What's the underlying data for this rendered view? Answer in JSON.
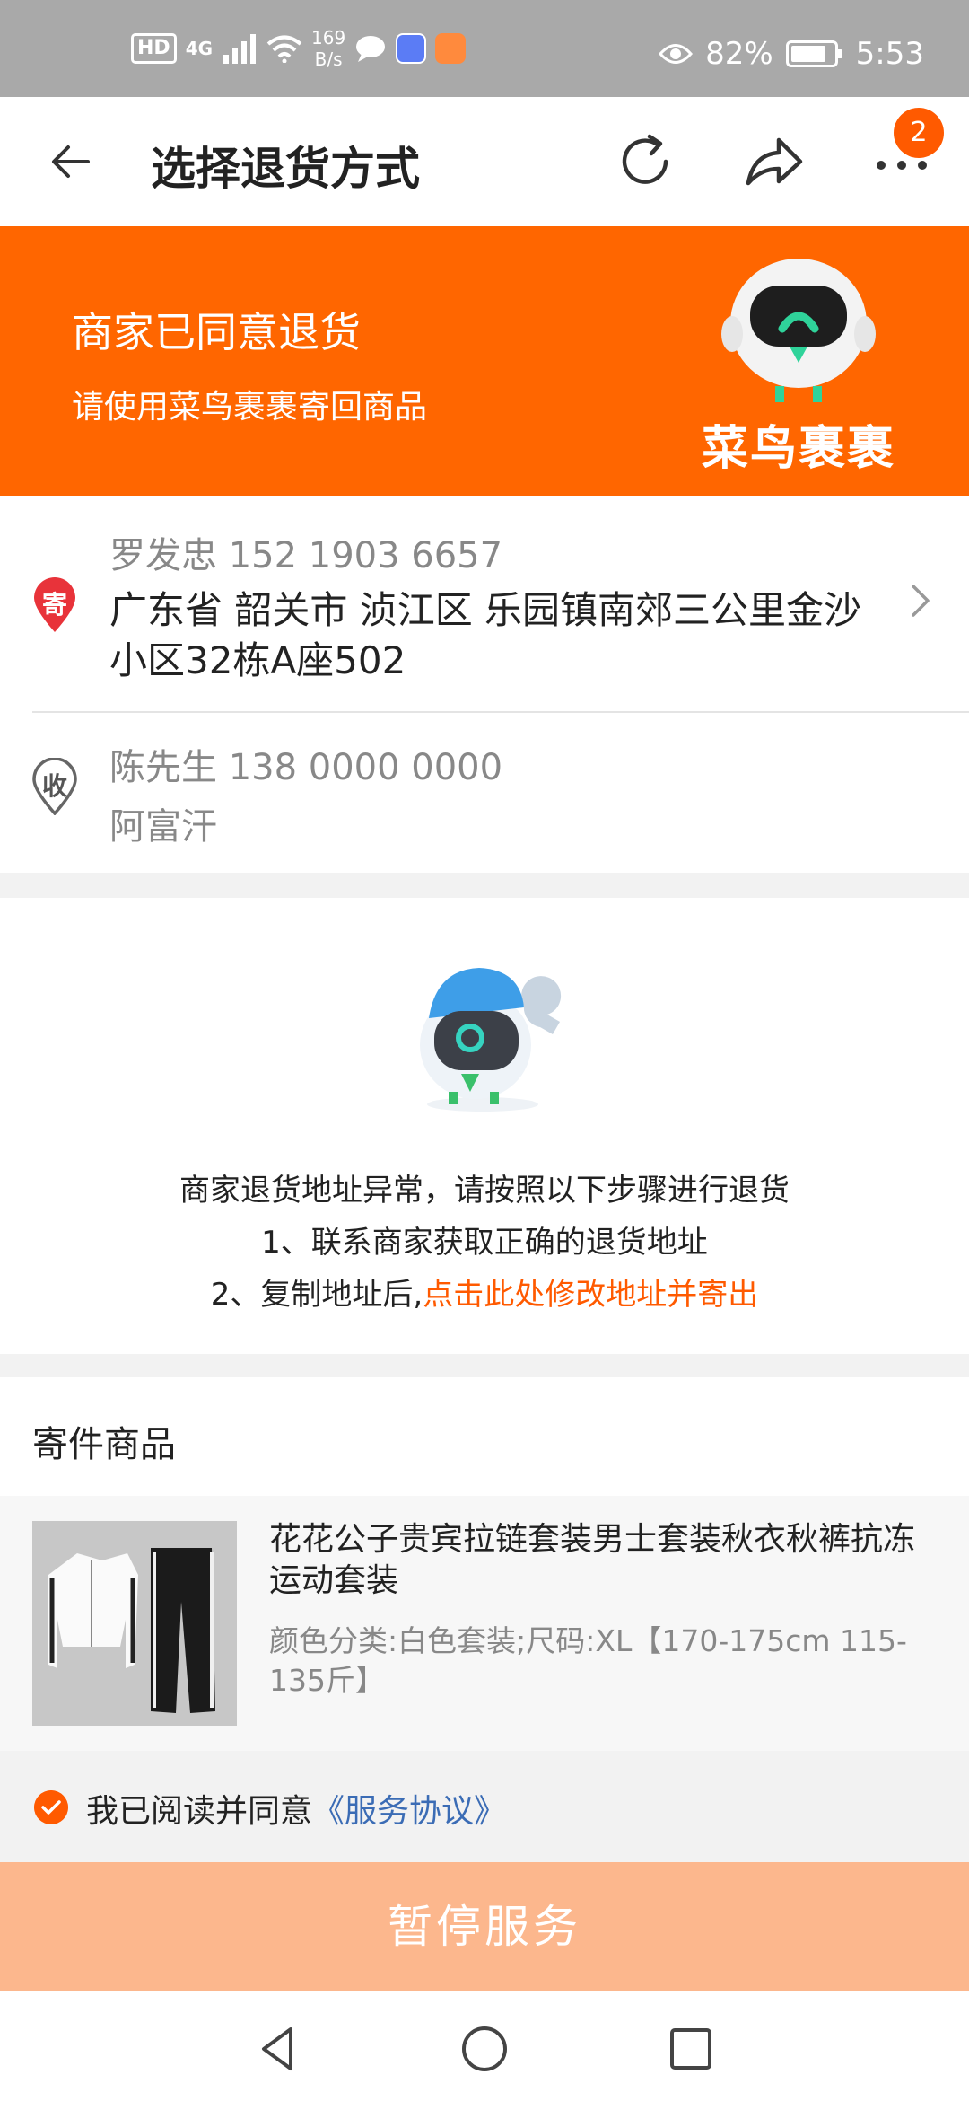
{
  "status_bar": {
    "hd": "HD",
    "network": "4G",
    "speed_value": "169",
    "speed_unit": "B/s",
    "battery": "82%",
    "time": "5:53"
  },
  "nav": {
    "title": "选择退货方式",
    "badge_count": "2"
  },
  "banner": {
    "heading": "商家已同意退货",
    "subheading": "请使用菜鸟裹裹寄回商品",
    "logo_text": "菜鸟裹裹"
  },
  "sender": {
    "pin_label": "寄",
    "name_phone": "罗发忠  152 1903 6657",
    "address": "广东省 韶关市 浈江区 乐园镇南郊三公里金沙小区32栋A座502"
  },
  "receiver": {
    "pin_label": "收",
    "name_phone": "陈先生  138 0000 0000",
    "address": "阿富汗"
  },
  "notice": {
    "line1": "商家退货地址异常，请按照以下步骤进行退货",
    "line2": "1、联系商家获取正确的退货地址",
    "line3_prefix": "2、复制地址后,",
    "line3_link": "点击此处修改地址并寄出"
  },
  "goods": {
    "section_title": "寄件商品",
    "name": "花花公子贵宾拉链套装男士套装秋衣秋裤抗冻运动套装",
    "spec": "颜色分类:白色套装;尺码:XL【170-175cm 115-135斤】"
  },
  "agreement": {
    "text": "我已阅读并同意",
    "link": "《服务协议》",
    "checked": true
  },
  "action_button": {
    "label": "暂停服务"
  },
  "colors": {
    "brand_orange": "#ff6600",
    "button_disabled": "#fcb78d",
    "link_blue": "#3b6cb5"
  }
}
